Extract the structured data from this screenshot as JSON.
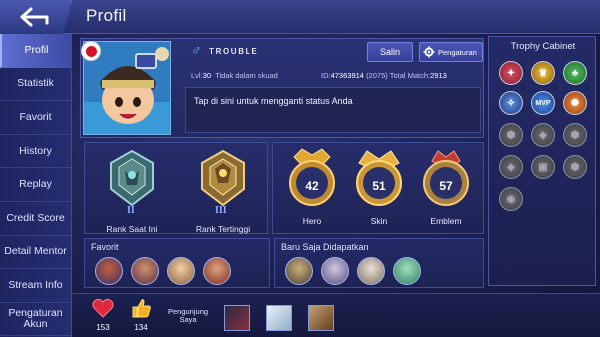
{
  "header": {
    "title": "Profil"
  },
  "sidebar": {
    "items": [
      {
        "label": "Profil",
        "active": true
      },
      {
        "label": "Statistik",
        "active": false
      },
      {
        "label": "Favorit",
        "active": false
      },
      {
        "label": "History",
        "active": false
      },
      {
        "label": "Replay",
        "active": false
      },
      {
        "label": "Credit Score",
        "active": false
      },
      {
        "label": "Detail Mentor",
        "active": false
      },
      {
        "label": "Stream Info",
        "active": false
      },
      {
        "label": "Pengaturan Akun",
        "active": false
      }
    ]
  },
  "profile": {
    "gender_icon": "male-symbol-icon",
    "name": "ᴛʀᴏᴜʙʟᴇ",
    "level_label": "Lvl:",
    "level": "30",
    "squad_status": "Tidak dalam skuad",
    "id_label": "ID:",
    "id": "47363914",
    "server": "(2075)",
    "total_match_label": "Total Match:",
    "total_match": "2913",
    "copy_label": "Salin",
    "settings_label": "Pengaturan",
    "status_placeholder": "Tap di sini untuk mengganti status Anda",
    "flag": "japan-flag-icon"
  },
  "ranks": {
    "current": {
      "label": "Rank Saat Ini",
      "tier": "II",
      "badge": "mythic-rank-icon"
    },
    "highest": {
      "label": "Rank Tertinggi",
      "tier": "III",
      "badge": "legend-rank-icon"
    }
  },
  "collection": {
    "hero": {
      "label": "Hero",
      "count": "42"
    },
    "skin": {
      "label": "Skin",
      "count": "51"
    },
    "emblem": {
      "label": "Emblem",
      "count": "57"
    }
  },
  "favorites": {
    "heading": "Favorit",
    "heroes": [
      "hero-portrait-1",
      "hero-portrait-2",
      "hero-portrait-3",
      "hero-portrait-4"
    ]
  },
  "recent": {
    "heading": "Baru Saja Didapatkan",
    "heroes": [
      "hero-portrait-5",
      "hero-portrait-6",
      "hero-portrait-7",
      "hero-portrait-8"
    ]
  },
  "trophy_cabinet": {
    "title": "Trophy Cabinet",
    "mvp_label": "MVP",
    "trophies": [
      {
        "name": "red-emblem-trophy-icon",
        "state": "earned",
        "color": "#c23040"
      },
      {
        "name": "gold-cup-trophy-icon",
        "state": "earned",
        "color": "#d4a020"
      },
      {
        "name": "green-squad-trophy-icon",
        "state": "earned",
        "color": "#2f9a3a"
      },
      {
        "name": "blue-emblem-trophy-icon",
        "state": "earned",
        "color": "#3a64c4"
      },
      {
        "name": "mvp-trophy-icon",
        "state": "earned",
        "color": "#2d6fd0"
      },
      {
        "name": "orange-emblem-trophy-icon",
        "state": "earned",
        "color": "#d06a20"
      },
      {
        "name": "locked-trophy-icon",
        "state": "locked"
      },
      {
        "name": "locked-trophy-icon",
        "state": "locked"
      },
      {
        "name": "locked-trophy-icon",
        "state": "locked"
      },
      {
        "name": "locked-trophy-icon",
        "state": "locked"
      },
      {
        "name": "locked-trophy-icon",
        "state": "locked"
      },
      {
        "name": "locked-trophy-icon",
        "state": "locked"
      },
      {
        "name": "locked-trophy-icon",
        "state": "locked"
      }
    ]
  },
  "bottom": {
    "likes": "153",
    "thumbs": "134",
    "visitors_label_line1": "Pengunjung",
    "visitors_label_line2": "Saya",
    "visitors": [
      "visitor-avatar-1",
      "visitor-avatar-2",
      "visitor-avatar-3"
    ]
  },
  "colors": {
    "accent": "#5e6fd0",
    "background": "#1c1f4e",
    "heart": "#e0283c",
    "thumb": "#f0b020",
    "gold": "#d4a020"
  }
}
